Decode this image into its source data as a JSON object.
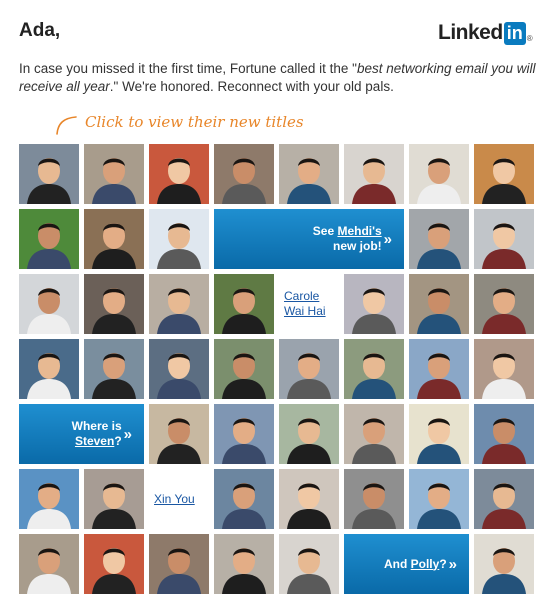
{
  "greeting": "Ada,",
  "logo": {
    "text": "Linked",
    "box": "in",
    "reg": "®"
  },
  "intro": {
    "part1": "In case you missed it the first time, Fortune called it the \"",
    "quote": "best networking email you will receive all year",
    "part2": ".\" We're honored. Reconnect with your old pals."
  },
  "hint": "Click to view their new titles",
  "names": {
    "carole_line1": "Carole",
    "carole_line2": "Wai Hai",
    "xin": "Xin You"
  },
  "promos": {
    "mehdi": {
      "pre": "See ",
      "name": "Mehdi's",
      "post": "new job!",
      "chev": "»"
    },
    "steven": {
      "pre": "Where is",
      "name": "Steven",
      "post": "?",
      "chev": "»"
    },
    "polly": {
      "pre": "And ",
      "name": "Polly",
      "post": "?",
      "chev": "»"
    }
  },
  "colors": {
    "brand": "#0a7bbf",
    "hint": "#e8862a",
    "link": "#1a57a3"
  }
}
